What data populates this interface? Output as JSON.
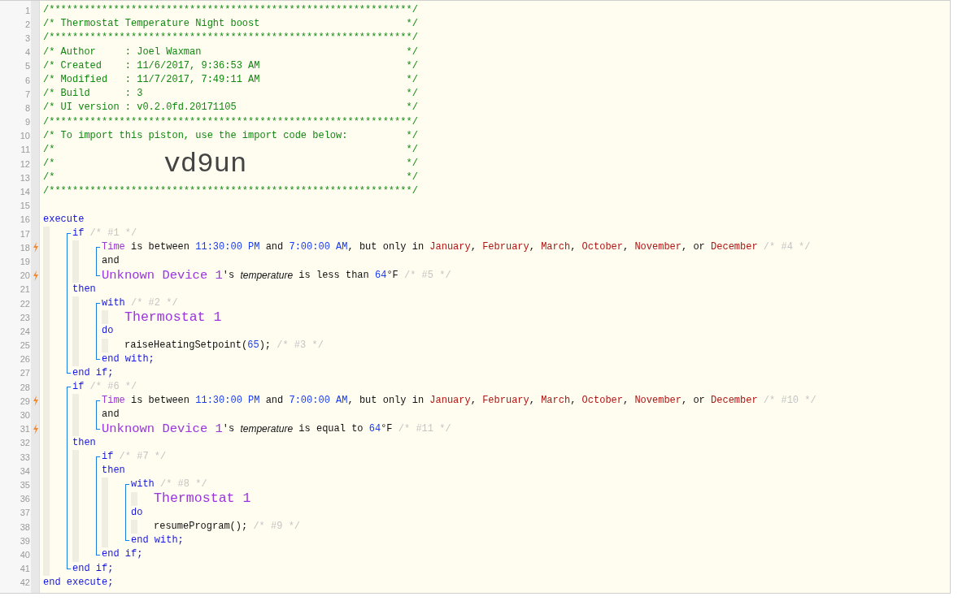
{
  "editor": {
    "lines": [
      {
        "kind": "banner",
        "number": "1",
        "trigger": false,
        "text": "/**************************************************************/"
      },
      {
        "kind": "banner",
        "number": "2",
        "trigger": false,
        "text": "/* Thermostat Temperature Night boost",
        "end": "*/"
      },
      {
        "kind": "banner",
        "number": "3",
        "trigger": false,
        "text": "/**************************************************************/"
      },
      {
        "kind": "banner",
        "number": "4",
        "trigger": false,
        "text": "/* Author     : Joel Waxman",
        "end": "*/"
      },
      {
        "kind": "banner",
        "number": "5",
        "trigger": false,
        "text": "/* Created    : 11/6/2017, 9:36:53 AM",
        "end": "*/"
      },
      {
        "kind": "banner",
        "number": "6",
        "trigger": false,
        "text": "/* Modified   : 11/7/2017, 7:49:11 AM",
        "end": "*/"
      },
      {
        "kind": "banner",
        "number": "7",
        "trigger": false,
        "text": "/* Build      : 3",
        "end": "*/"
      },
      {
        "kind": "banner",
        "number": "8",
        "trigger": false,
        "text": "/* UI version : v0.2.0fd.20171105",
        "end": "*/"
      },
      {
        "kind": "banner",
        "number": "9",
        "trigger": false,
        "text": "/**************************************************************/"
      },
      {
        "kind": "banner",
        "number": "10",
        "trigger": false,
        "text": "/* To import this piston, use the import code below:",
        "end": "*/"
      },
      {
        "kind": "banner",
        "number": "11",
        "trigger": false,
        "text": "/*",
        "end": "*/"
      },
      {
        "kind": "banner",
        "number": "12",
        "trigger": false,
        "text": "/*",
        "import_code": "vd9un",
        "end": "*/"
      },
      {
        "kind": "banner",
        "number": "13",
        "trigger": false,
        "text": "/*",
        "end": "*/"
      },
      {
        "kind": "banner",
        "number": "14",
        "trigger": false,
        "text": "/**************************************************************/"
      },
      {
        "kind": "line",
        "number": "15",
        "trigger": false
      },
      {
        "kind": "line",
        "number": "16",
        "trigger": false,
        "tokens": [
          {
            "kind": "kw",
            "text": "execute"
          }
        ]
      },
      {
        "kind": "indent",
        "children": [
          {
            "kind": "block",
            "children": [
              {
                "kind": "line",
                "number": "17",
                "trigger": false,
                "tokens": [
                  {
                    "kind": "kw",
                    "text": "if"
                  },
                  {
                    "kind": "comment",
                    "text": " /* #1 */"
                  }
                ]
              },
              {
                "kind": "indent",
                "children": [
                  {
                    "kind": "block",
                    "children": [
                      {
                        "kind": "line",
                        "number": "18",
                        "trigger": true,
                        "tokens": [
                          {
                            "kind": "attr",
                            "text": "Time"
                          },
                          {
                            "kind": "plain",
                            "text": " is between "
                          },
                          {
                            "kind": "value",
                            "text": "11:30:00 PM"
                          },
                          {
                            "kind": "plain",
                            "text": " and "
                          },
                          {
                            "kind": "value",
                            "text": "7:00:00 AM"
                          },
                          {
                            "kind": "plain",
                            "text": ", but only in "
                          },
                          {
                            "kind": "month",
                            "text": "January"
                          },
                          {
                            "kind": "plain",
                            "text": ", "
                          },
                          {
                            "kind": "month",
                            "text": "February"
                          },
                          {
                            "kind": "plain",
                            "text": ", "
                          },
                          {
                            "kind": "month",
                            "text": "March"
                          },
                          {
                            "kind": "plain",
                            "text": ", "
                          },
                          {
                            "kind": "month",
                            "text": "October"
                          },
                          {
                            "kind": "plain",
                            "text": ", "
                          },
                          {
                            "kind": "month",
                            "text": "November"
                          },
                          {
                            "kind": "plain",
                            "text": ", or "
                          },
                          {
                            "kind": "month",
                            "text": "December"
                          },
                          {
                            "kind": "comment",
                            "text": " /* #4 */"
                          }
                        ]
                      },
                      {
                        "kind": "line",
                        "number": "19",
                        "trigger": false,
                        "tokens": [
                          {
                            "kind": "plain",
                            "text": "and"
                          }
                        ]
                      },
                      {
                        "kind": "line",
                        "number": "20",
                        "trigger": true,
                        "tokens": [
                          {
                            "kind": "device",
                            "text": "Unknown Device 1"
                          },
                          {
                            "kind": "plain",
                            "text": "'s "
                          },
                          {
                            "kind": "italic",
                            "text": "temperature"
                          },
                          {
                            "kind": "plain",
                            "text": " is less than "
                          },
                          {
                            "kind": "value",
                            "text": "64"
                          },
                          {
                            "kind": "plain",
                            "text": "°F"
                          },
                          {
                            "kind": "comment",
                            "text": " /* #5 */"
                          }
                        ]
                      }
                    ]
                  }
                ]
              },
              {
                "kind": "line",
                "number": "21",
                "trigger": false,
                "tokens": [
                  {
                    "kind": "kw",
                    "text": "then"
                  }
                ]
              },
              {
                "kind": "indent",
                "children": [
                  {
                    "kind": "block",
                    "children": [
                      {
                        "kind": "line",
                        "number": "22",
                        "trigger": false,
                        "tokens": [
                          {
                            "kind": "kw",
                            "text": "with"
                          },
                          {
                            "kind": "comment",
                            "text": " /* #2 */"
                          }
                        ]
                      },
                      {
                        "kind": "indent",
                        "children": [
                          {
                            "kind": "line",
                            "number": "23",
                            "trigger": false,
                            "tokens": [
                              {
                                "kind": "subject",
                                "text": "Thermostat 1"
                              }
                            ]
                          }
                        ]
                      },
                      {
                        "kind": "line",
                        "number": "24",
                        "trigger": false,
                        "tokens": [
                          {
                            "kind": "kw",
                            "text": "do"
                          }
                        ]
                      },
                      {
                        "kind": "indent",
                        "children": [
                          {
                            "kind": "line",
                            "number": "25",
                            "trigger": false,
                            "tokens": [
                              {
                                "kind": "plain",
                                "text": "raiseHeatingSetpoint("
                              },
                              {
                                "kind": "value",
                                "text": "65"
                              },
                              {
                                "kind": "plain",
                                "text": ");"
                              },
                              {
                                "kind": "comment",
                                "text": " /* #3 */"
                              }
                            ]
                          }
                        ]
                      },
                      {
                        "kind": "line",
                        "number": "26",
                        "trigger": false,
                        "tokens": [
                          {
                            "kind": "kw",
                            "text": "end with;"
                          }
                        ]
                      }
                    ]
                  }
                ]
              },
              {
                "kind": "line",
                "number": "27",
                "trigger": false,
                "tokens": [
                  {
                    "kind": "kw",
                    "text": "end if;"
                  }
                ]
              }
            ]
          },
          {
            "kind": "block",
            "children": [
              {
                "kind": "line",
                "number": "28",
                "trigger": false,
                "tokens": [
                  {
                    "kind": "kw",
                    "text": "if"
                  },
                  {
                    "kind": "comment",
                    "text": " /* #6 */"
                  }
                ]
              },
              {
                "kind": "indent",
                "children": [
                  {
                    "kind": "block",
                    "children": [
                      {
                        "kind": "line",
                        "number": "29",
                        "trigger": true,
                        "tokens": [
                          {
                            "kind": "attr",
                            "text": "Time"
                          },
                          {
                            "kind": "plain",
                            "text": " is between "
                          },
                          {
                            "kind": "value",
                            "text": "11:30:00 PM"
                          },
                          {
                            "kind": "plain",
                            "text": " and "
                          },
                          {
                            "kind": "value",
                            "text": "7:00:00 AM"
                          },
                          {
                            "kind": "plain",
                            "text": ", but only in "
                          },
                          {
                            "kind": "month",
                            "text": "January"
                          },
                          {
                            "kind": "plain",
                            "text": ", "
                          },
                          {
                            "kind": "month",
                            "text": "February"
                          },
                          {
                            "kind": "plain",
                            "text": ", "
                          },
                          {
                            "kind": "month",
                            "text": "March"
                          },
                          {
                            "kind": "plain",
                            "text": ", "
                          },
                          {
                            "kind": "month",
                            "text": "October"
                          },
                          {
                            "kind": "plain",
                            "text": ", "
                          },
                          {
                            "kind": "month",
                            "text": "November"
                          },
                          {
                            "kind": "plain",
                            "text": ", or "
                          },
                          {
                            "kind": "month",
                            "text": "December"
                          },
                          {
                            "kind": "comment",
                            "text": " /* #10 */"
                          }
                        ]
                      },
                      {
                        "kind": "line",
                        "number": "30",
                        "trigger": false,
                        "tokens": [
                          {
                            "kind": "plain",
                            "text": "and"
                          }
                        ]
                      },
                      {
                        "kind": "line",
                        "number": "31",
                        "trigger": true,
                        "tokens": [
                          {
                            "kind": "device",
                            "text": "Unknown Device 1"
                          },
                          {
                            "kind": "plain",
                            "text": "'s "
                          },
                          {
                            "kind": "italic",
                            "text": "temperature"
                          },
                          {
                            "kind": "plain",
                            "text": " is equal to "
                          },
                          {
                            "kind": "value",
                            "text": "64"
                          },
                          {
                            "kind": "plain",
                            "text": "°F"
                          },
                          {
                            "kind": "comment",
                            "text": " /* #11 */"
                          }
                        ]
                      }
                    ]
                  }
                ]
              },
              {
                "kind": "line",
                "number": "32",
                "trigger": false,
                "tokens": [
                  {
                    "kind": "kw",
                    "text": "then"
                  }
                ]
              },
              {
                "kind": "indent",
                "children": [
                  {
                    "kind": "block",
                    "children": [
                      {
                        "kind": "line",
                        "number": "33",
                        "trigger": false,
                        "tokens": [
                          {
                            "kind": "kw",
                            "text": "if"
                          },
                          {
                            "kind": "comment",
                            "text": " /* #7 */"
                          }
                        ]
                      },
                      {
                        "kind": "line",
                        "number": "34",
                        "trigger": false,
                        "tokens": [
                          {
                            "kind": "kw",
                            "text": "then"
                          }
                        ]
                      },
                      {
                        "kind": "indent",
                        "children": [
                          {
                            "kind": "block",
                            "children": [
                              {
                                "kind": "line",
                                "number": "35",
                                "trigger": false,
                                "tokens": [
                                  {
                                    "kind": "kw",
                                    "text": "with"
                                  },
                                  {
                                    "kind": "comment",
                                    "text": " /* #8 */"
                                  }
                                ]
                              },
                              {
                                "kind": "indent",
                                "children": [
                                  {
                                    "kind": "line",
                                    "number": "36",
                                    "trigger": false,
                                    "tokens": [
                                      {
                                        "kind": "subject",
                                        "text": "Thermostat 1"
                                      }
                                    ]
                                  }
                                ]
                              },
                              {
                                "kind": "line",
                                "number": "37",
                                "trigger": false,
                                "tokens": [
                                  {
                                    "kind": "kw",
                                    "text": "do"
                                  }
                                ]
                              },
                              {
                                "kind": "indent",
                                "children": [
                                  {
                                    "kind": "line",
                                    "number": "38",
                                    "trigger": false,
                                    "tokens": [
                                      {
                                        "kind": "plain",
                                        "text": "resumeProgram();"
                                      },
                                      {
                                        "kind": "comment",
                                        "text": " /* #9 */"
                                      }
                                    ]
                                  }
                                ]
                              },
                              {
                                "kind": "line",
                                "number": "39",
                                "trigger": false,
                                "tokens": [
                                  {
                                    "kind": "kw",
                                    "text": "end with;"
                                  }
                                ]
                              }
                            ]
                          }
                        ]
                      },
                      {
                        "kind": "line",
                        "number": "40",
                        "trigger": false,
                        "tokens": [
                          {
                            "kind": "kw",
                            "text": "end if;"
                          }
                        ]
                      }
                    ]
                  }
                ]
              },
              {
                "kind": "line",
                "number": "41",
                "trigger": false,
                "tokens": [
                  {
                    "kind": "kw",
                    "text": "end if;"
                  }
                ]
              }
            ]
          }
        ]
      },
      {
        "kind": "line",
        "number": "42",
        "trigger": false,
        "tokens": [
          {
            "kind": "kw",
            "text": "end execute;"
          }
        ]
      }
    ]
  }
}
